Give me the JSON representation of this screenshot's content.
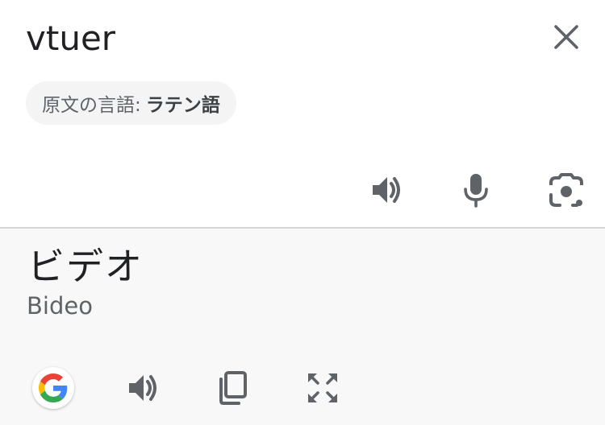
{
  "source": {
    "text": "vtuer",
    "detected_label": "原文の言語:",
    "detected_language": "ラテン語"
  },
  "target": {
    "text": "ビデオ",
    "romanization": "Bideo"
  },
  "icons": {
    "close": "close-icon",
    "source_speaker": "speaker-icon",
    "microphone": "microphone-icon",
    "lens": "camera-lens-icon",
    "google": "google-logo-icon",
    "target_speaker": "speaker-icon",
    "copy": "copy-icon",
    "fullscreen": "fullscreen-icon"
  },
  "colors": {
    "icon": "#5f6368",
    "target_background": "#f8f8f8",
    "chip_background": "#f4f4f4",
    "google_blue": "#4285F4",
    "google_red": "#EA4335",
    "google_yellow": "#FBBC05",
    "google_green": "#34A853"
  }
}
